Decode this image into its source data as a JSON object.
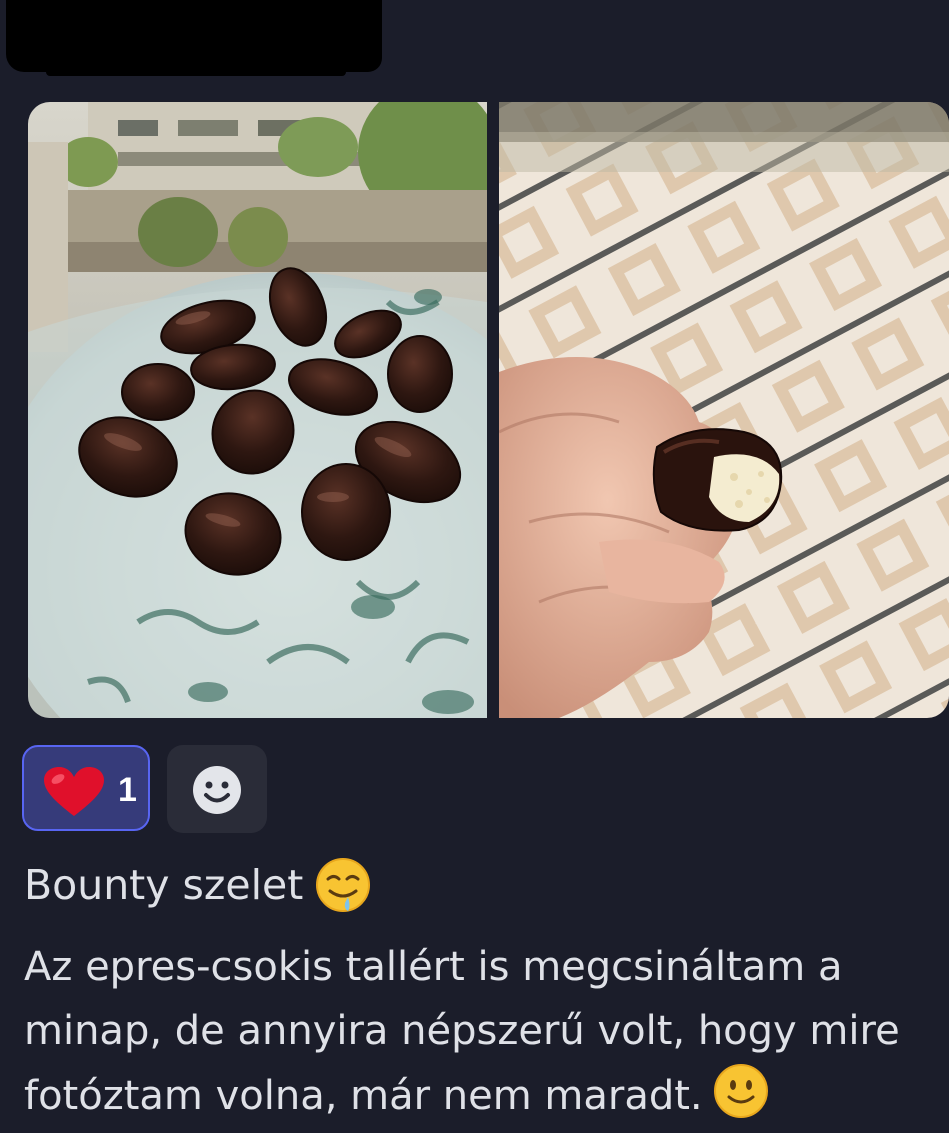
{
  "message": {
    "title_text": "Bounty szelet",
    "title_emoji": "drooling-face-emoji",
    "body_lines": [
      "Az epres-csokis tallért is megcsináltam a",
      "minap, de annyira népszerű volt, hogy mire",
      "fotóztam volna, már nem maradt."
    ],
    "body_emoji": "slightly-smiling-face-emoji"
  },
  "reactions": [
    {
      "emoji": "red-heart-emoji",
      "count": "1",
      "selected": true
    }
  ],
  "add_reaction_icon": "smiley-add-reaction-icon",
  "attachments": [
    {
      "kind": "image",
      "subject": "chocolate-covered coconut bars on a plate"
    },
    {
      "kind": "image",
      "subject": "hand holding bitten coconut chocolate bar"
    }
  ],
  "colors": {
    "background": "#1b1d2a",
    "text": "#dfe1e7",
    "reaction_selected_bg": "#363b7a",
    "reaction_selected_border": "#5865f2",
    "add_reaction_bg": "#2a2c38",
    "heart": "#e0102b"
  }
}
